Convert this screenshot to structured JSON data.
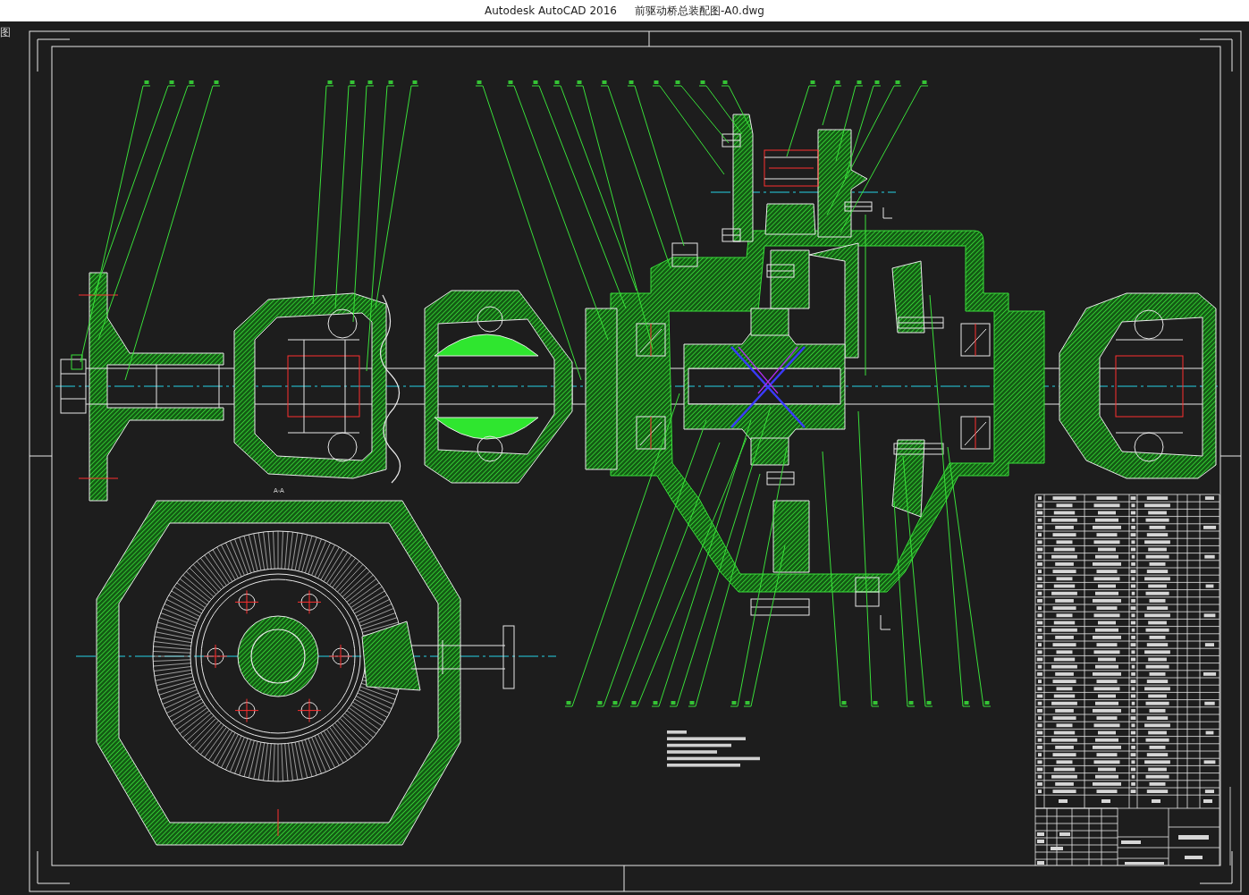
{
  "window": {
    "app_name": "Autodesk AutoCAD 2016",
    "file_name": "前驱动桥总装配图-A0.dwg"
  },
  "viewport": {
    "label": "图"
  },
  "drawing": {
    "section_label": "A-A"
  }
}
